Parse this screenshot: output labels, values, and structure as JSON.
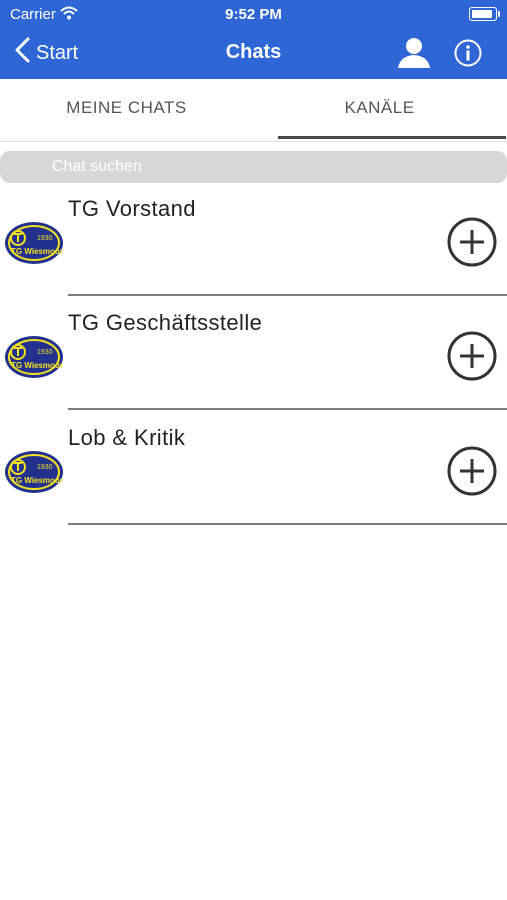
{
  "status_bar": {
    "carrier": "Carrier",
    "time": "9:52 PM"
  },
  "nav": {
    "back_label": "Start",
    "title": "Chats",
    "icons": [
      "chevron-left-icon",
      "user-icon",
      "info-icon"
    ]
  },
  "tabs": [
    {
      "label": "MEINE CHATS",
      "selected": false
    },
    {
      "label": "KANÄLE",
      "selected": true
    }
  ],
  "search": {
    "placeholder": "Chat suchen",
    "value": ""
  },
  "channels": [
    {
      "name": "TG Vorstand",
      "logo": {
        "year": "1930",
        "text": "TG Wiesmoor"
      }
    },
    {
      "name": "TG Geschäftsstelle",
      "logo": {
        "year": "1930",
        "text": "TG Wiesmoor"
      }
    },
    {
      "name": "Lob & Kritik",
      "logo": {
        "year": "1930",
        "text": "TG Wiesmoor"
      }
    }
  ],
  "colors": {
    "header": "#2f66d6",
    "logo_blue": "#23318e",
    "logo_yellow": "#f2e21f"
  }
}
